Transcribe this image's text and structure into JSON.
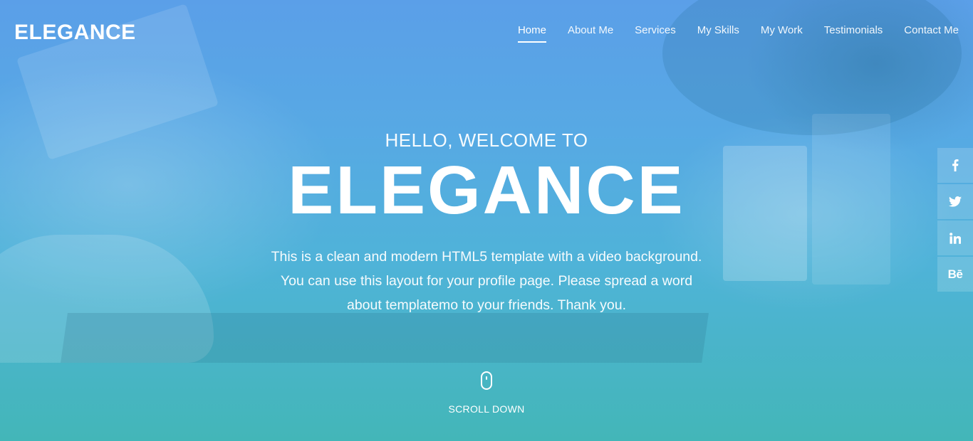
{
  "header": {
    "logo": "ELEGANCE",
    "nav": [
      {
        "label": "Home",
        "active": true
      },
      {
        "label": "About Me"
      },
      {
        "label": "Services"
      },
      {
        "label": "My Skills"
      },
      {
        "label": "My Work"
      },
      {
        "label": "Testimonials"
      },
      {
        "label": "Contact Me"
      }
    ]
  },
  "hero": {
    "greeting": "HELLO, WELCOME TO",
    "title": "ELEGANCE",
    "description": "This is a clean and modern HTML5 template with a video background. You can use this layout for your profile page. Please spread a word about templatemo to your friends. Thank you."
  },
  "scroll": {
    "label": "SCROLL DOWN",
    "icon": "mouse-icon"
  },
  "social": [
    {
      "name": "facebook",
      "icon": "facebook-icon"
    },
    {
      "name": "twitter",
      "icon": "twitter-icon"
    },
    {
      "name": "linkedin",
      "icon": "linkedin-icon"
    },
    {
      "name": "behance",
      "icon": "behance-icon",
      "text": "Bē"
    }
  ],
  "colors": {
    "gradient_top": "#5b9fe8",
    "gradient_bottom": "#43b6b8",
    "text": "#ffffff"
  }
}
